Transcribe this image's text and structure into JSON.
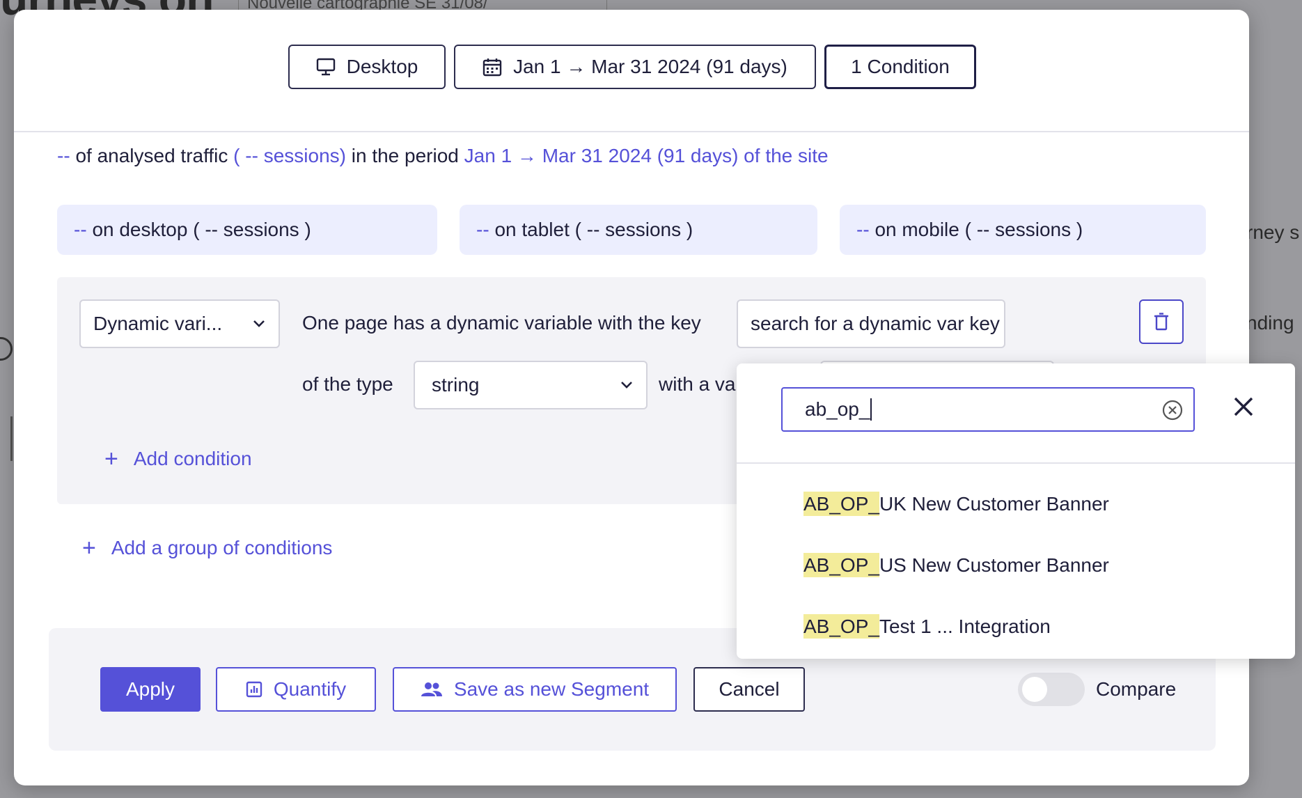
{
  "background": {
    "title_fragment": "urneys on",
    "crumb": "Nouvelle cartographie SE 31/08/",
    "right_text_1": "rney s",
    "right_text_2": "nding"
  },
  "topbar": {
    "device_label": "Desktop",
    "date_label": "Jan 1 → Mar 31 2024 (91 days)",
    "conditions_label": "1 Condition"
  },
  "summary": {
    "pct": "--",
    "text1": "of analysed traffic",
    "sessions": "( -- sessions)",
    "text2": "in the period",
    "period": "Jan 1 → Mar 31 2024 (91 days) of the site"
  },
  "devices": [
    {
      "pct": "--",
      "label": "on desktop ( -- sessions )"
    },
    {
      "pct": "--",
      "label": "on tablet ( -- sessions )"
    },
    {
      "pct": "--",
      "label": "on mobile ( -- sessions )"
    }
  ],
  "condition": {
    "type_select": "Dynamic vari...",
    "sentence": "One page has a dynamic variable with the key",
    "key_placeholder": "search for a dynamic var key",
    "of_type": "of the type",
    "type_value": "string",
    "with_value": "with a va"
  },
  "actions": {
    "add_condition": "Add condition",
    "add_group": "Add a group of conditions"
  },
  "footer": {
    "apply": "Apply",
    "quantify": "Quantify",
    "save_segment": "Save as new Segment",
    "cancel": "Cancel",
    "compare": "Compare",
    "compare_on": false
  },
  "dropdown": {
    "search_value": "ab_op_",
    "options": [
      {
        "match": "AB_OP_",
        "rest": "UK New Customer Banner"
      },
      {
        "match": "AB_OP_",
        "rest": "US New Customer Banner"
      },
      {
        "match": "AB_OP_",
        "rest": "Test 1 ... Integration"
      }
    ]
  },
  "colors": {
    "accent": "#5551d8",
    "highlight": "#f3ec9a",
    "device_box_bg": "#eceefe",
    "panel_bg": "#f3f3f7"
  }
}
